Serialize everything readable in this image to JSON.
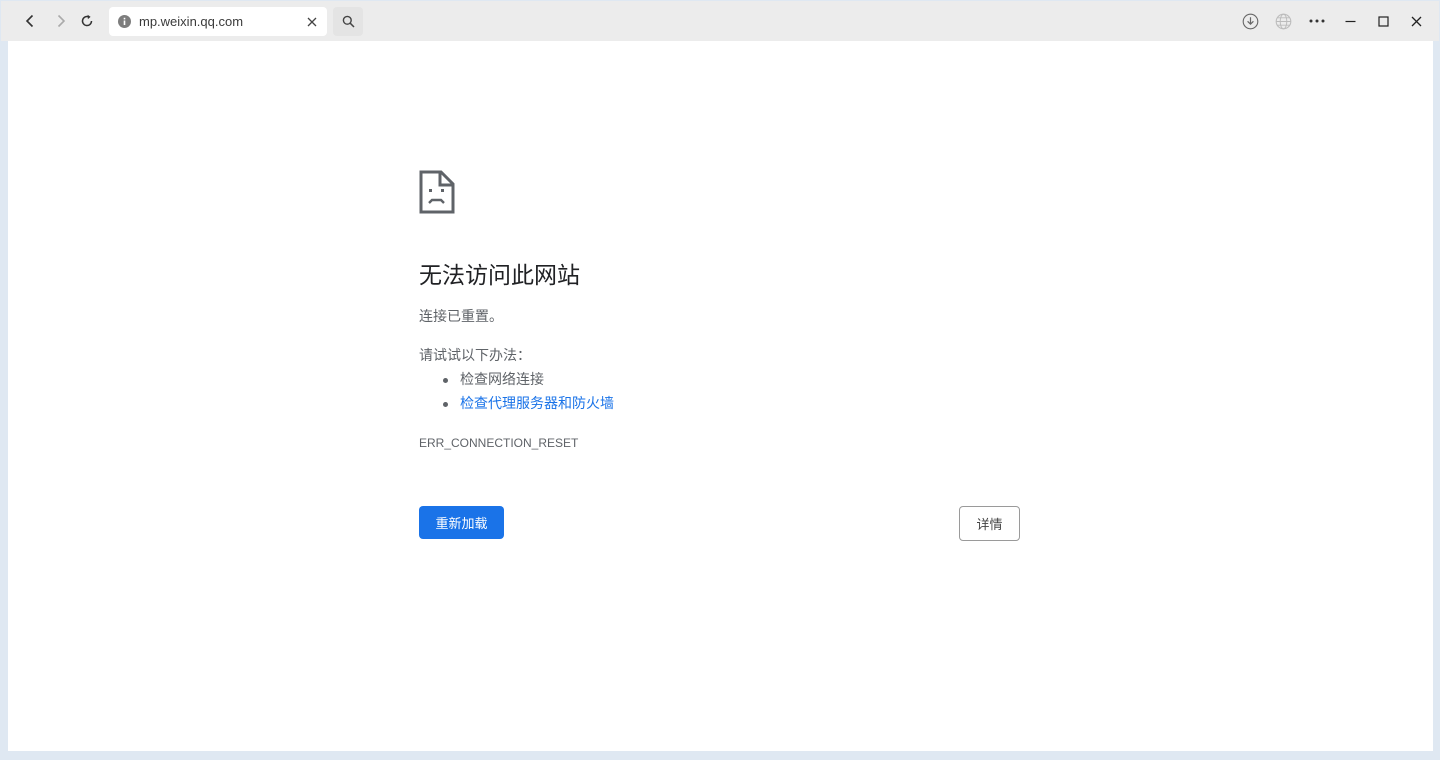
{
  "browser": {
    "url": "mp.weixin.qq.com"
  },
  "error_page": {
    "title": "无法访问此网站",
    "description": "连接已重置。",
    "suggestions_intro": "请试试以下办法：",
    "suggestions": [
      {
        "label": "检查网络连接",
        "is_link": false
      },
      {
        "label": "检查代理服务器和防火墙",
        "is_link": true
      }
    ],
    "error_code": "ERR_CONNECTION_RESET",
    "reload_label": "重新加载",
    "details_label": "详情"
  },
  "colors": {
    "accent": "#1a73e8",
    "toolbar_bg": "#ececec",
    "text_primary": "#202124",
    "text_secondary": "#5f6368"
  },
  "icons": {
    "back": "chevron-left-icon",
    "forward": "chevron-right-icon",
    "reload": "refresh-icon",
    "site_info": "info-icon",
    "clear": "close-icon",
    "search": "search-icon",
    "download": "download-icon",
    "translate": "globe-icon",
    "menu": "more-icon",
    "minimize": "minimize-icon",
    "maximize": "maximize-icon",
    "close": "close-window-icon",
    "error": "sad-page-icon"
  }
}
